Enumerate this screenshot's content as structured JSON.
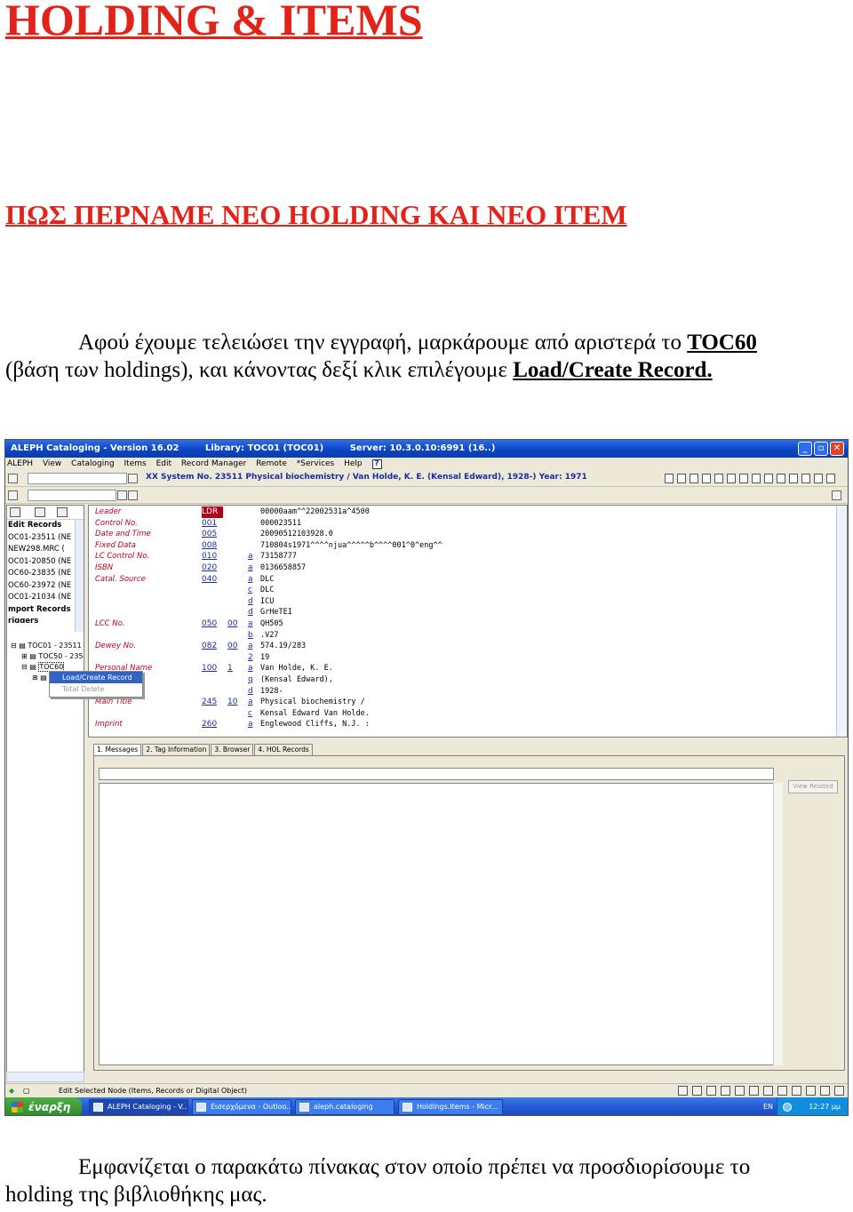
{
  "doc": {
    "title": "HOLDING & ITEMS",
    "subtitle": "ΠΩΣ ΠΕΡΝΑΜΕ ΝΕΟ HOLDING ΚΑΙ ΝΕΟ ITEM",
    "p1_line1": "Αφού έχουμε τελειώσει την εγγραφή, μαρκάρουμε από αριστερά το ",
    "p1_bold1": "TOC60",
    "p1_line2": "(βάση των holdings), και κάνοντας δεξί κλικ επιλέγουμε ",
    "p1_bold2": "Load/Create Record.",
    "p2_line1": "Εμφανίζεται ο παρακάτω πίνακας στον οποίο πρέπει να προσδιορίσουμε το",
    "p2_line2": "holding της βιβλιοθήκης μας."
  },
  "window": {
    "title_app": "ALEPH Cataloging - Version 16.02",
    "title_library": "Library: TOC01 (TOC01)",
    "title_server": "Server: 10.3.0.10:6991 (16..)",
    "menu": [
      "ALEPH",
      "View",
      "Cataloging",
      "Items",
      "Edit",
      "Record Manager",
      "Remote",
      "*Services",
      "Help"
    ],
    "help_icon": "?",
    "record_header": "XX System No. 23511 Physical biochemistry / Van Holde, K. E. (Kensal Edward), 1928-) Year: 1971"
  },
  "left_list": [
    "Edit Records",
    "OC01-23511 (NE",
    "NEW298.MRC (",
    "OC01-20850 (NE",
    "OC60-23835 (NE",
    "OC60-23972 (NE",
    "OC01-21034 (NE",
    "mport Records",
    "riggers"
  ],
  "tree": {
    "root": "TOC01 - 23511",
    "n1": "TOC50 - 235",
    "n2": "TOC60"
  },
  "context_menu": {
    "load_create": "Load/Create Record",
    "total_delete": "Total Delete"
  },
  "record": {
    "rows": [
      {
        "label": "Leader",
        "tag": "LDR",
        "ind": "",
        "sub": "",
        "value": "00000aam^^22002531a^4500"
      },
      {
        "label": "Control No.",
        "tag": "001",
        "ind": "",
        "sub": "",
        "value": "000023511"
      },
      {
        "label": "Date and Time",
        "tag": "005",
        "ind": "",
        "sub": "",
        "value": "20090512103928.0"
      },
      {
        "label": "Fixed Data",
        "tag": "008",
        "ind": "",
        "sub": "",
        "value": "710804s1971^^^^njua^^^^^b^^^^001^0^eng^^"
      },
      {
        "label": "LC Control No.",
        "tag": "010",
        "ind": "",
        "sub": "a",
        "value": "73158777"
      },
      {
        "label": "ISBN",
        "tag": "020",
        "ind": "",
        "sub": "a",
        "value": "0136658857"
      },
      {
        "label": "Catal. Source",
        "tag": "040",
        "ind": "",
        "sub": "a",
        "value": "DLC"
      },
      {
        "label": "",
        "tag": "",
        "ind": "",
        "sub": "c",
        "value": "DLC"
      },
      {
        "label": "",
        "tag": "",
        "ind": "",
        "sub": "d",
        "value": "ICU"
      },
      {
        "label": "",
        "tag": "",
        "ind": "",
        "sub": "d",
        "value": "GrHeTEI"
      },
      {
        "label": "LCC No.",
        "tag": "050",
        "ind": "00",
        "sub": "a",
        "value": "QH505"
      },
      {
        "label": "",
        "tag": "",
        "ind": "",
        "sub": "b",
        "value": ".V27"
      },
      {
        "label": "Dewey No.",
        "tag": "082",
        "ind": "00",
        "sub": "a",
        "value": "574.19/283"
      },
      {
        "label": "",
        "tag": "",
        "ind": "",
        "sub": "2",
        "value": "19"
      },
      {
        "label": "Personal Name",
        "tag": "100",
        "ind": "1",
        "sub": "a",
        "value": "Van Holde, K. E."
      },
      {
        "label": "",
        "tag": "",
        "ind": "",
        "sub": "q",
        "value": "(Kensal Edward),"
      },
      {
        "label": "",
        "tag": "",
        "ind": "",
        "sub": "d",
        "value": "1928-"
      },
      {
        "label": "Main Title",
        "tag": "245",
        "ind": "10",
        "sub": "a",
        "value": "Physical biochemistry /"
      },
      {
        "label": "",
        "tag": "",
        "ind": "",
        "sub": "c",
        "value": "Kensal Edward Van Holde."
      },
      {
        "label": "Imprint",
        "tag": "260",
        "ind": "",
        "sub": "a",
        "value": "Englewood Cliffs, N.J. :"
      }
    ]
  },
  "tabs": [
    "1. Messages",
    "2. Tag Information",
    "3. Browser",
    "4. HOL Records"
  ],
  "view_related": "View Related",
  "status_text": "Edit Selected Node (Items, Records or Digital Object)",
  "taskbar": {
    "start": "έναρξη",
    "tasks": [
      "ALEPH Cataloging - V...",
      "Εισερχόμενα - Outloo...",
      "aleph.cataloging",
      "Holdings.Items - Micr..."
    ],
    "lang": "EN",
    "clock": "12:27 μμ"
  }
}
